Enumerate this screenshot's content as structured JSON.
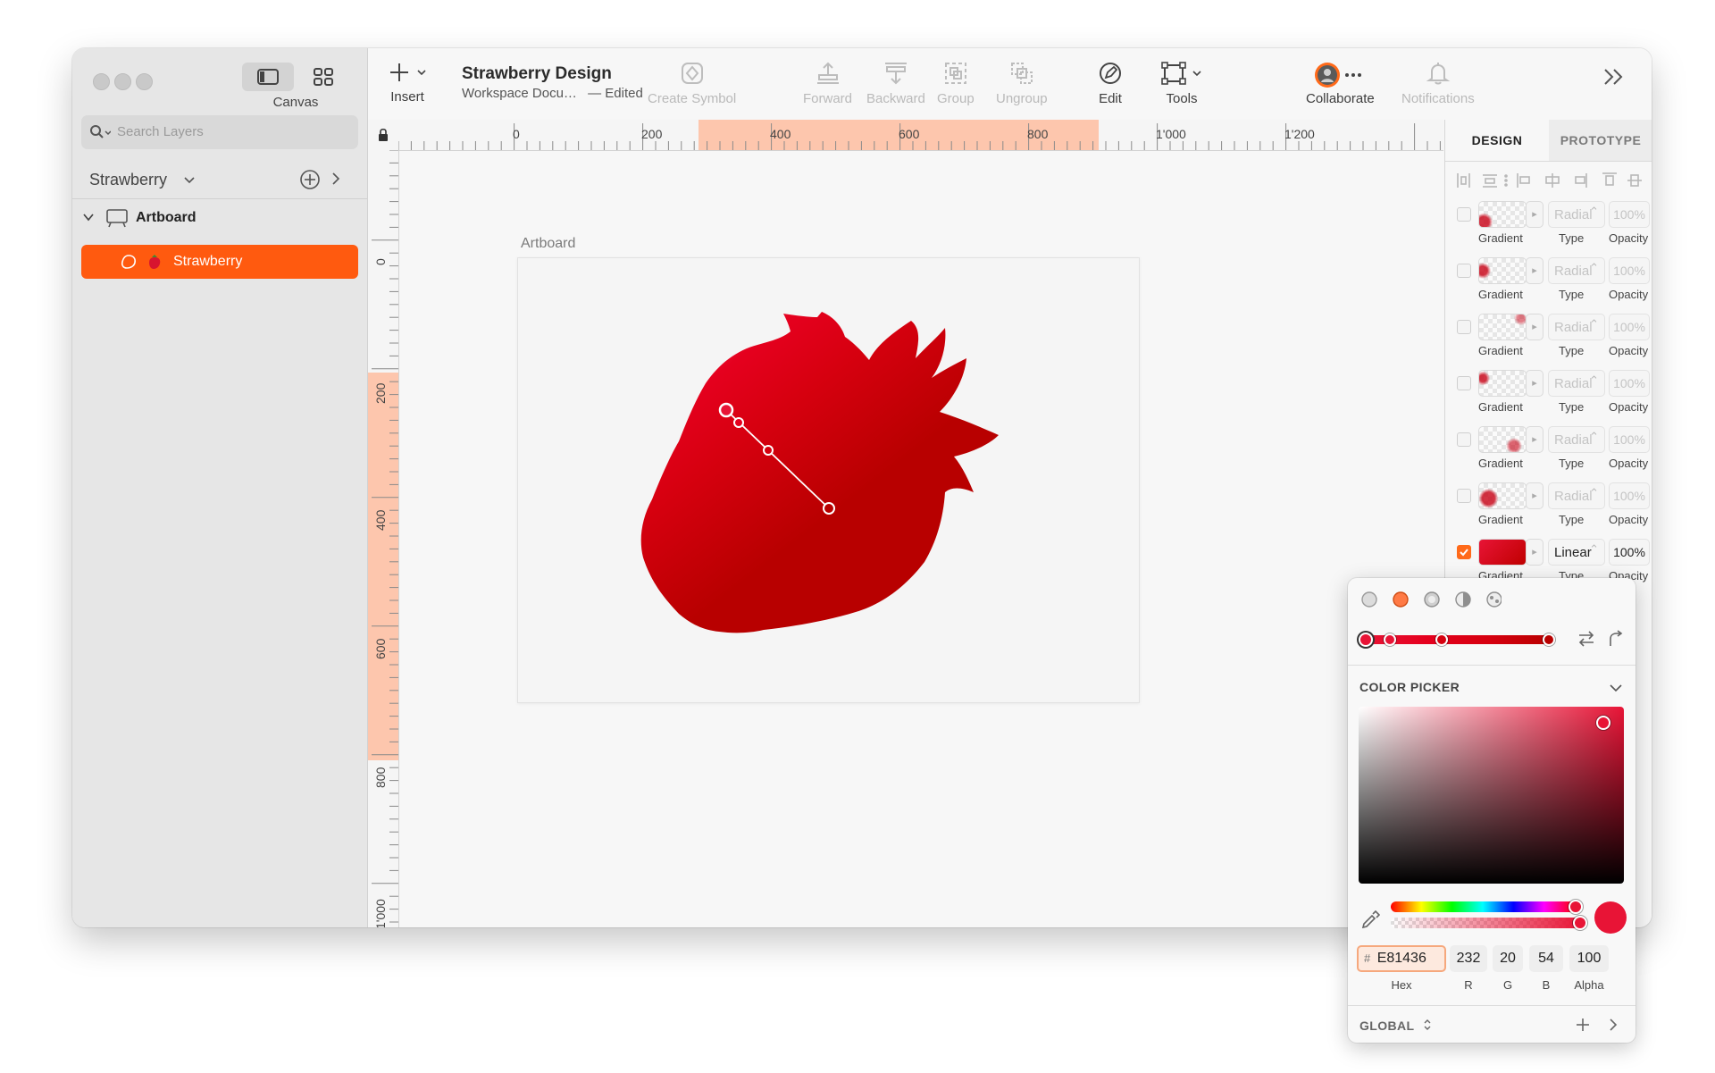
{
  "window": {
    "canvas_label": "Canvas",
    "search_placeholder": "Search Layers",
    "page_name": "Strawberry",
    "artboard_name": "Artboard",
    "layer_name": "Strawberry"
  },
  "toolbar": {
    "insert": "Insert",
    "doc_title": "Strawberry Design",
    "doc_location": "Workspace Docu…",
    "doc_status": "— Edited",
    "create_symbol": "Create Symbol",
    "forward": "Forward",
    "backward": "Backward",
    "group": "Group",
    "ungroup": "Ungroup",
    "edit": "Edit",
    "tools": "Tools",
    "collaborate": "Collaborate",
    "notifications": "Notifications"
  },
  "rulers": {
    "horizontal": [
      "0",
      "200",
      "400",
      "600",
      "800",
      "1'000",
      "1'200"
    ],
    "vertical": [
      "0",
      "200",
      "400",
      "600",
      "800",
      "1'000"
    ]
  },
  "canvas": {
    "artboard_title": "Artboard"
  },
  "inspector": {
    "tabs": [
      "DESIGN",
      "PROTOTYPE"
    ],
    "fills": [
      {
        "type": "Radial",
        "opacity": "100%",
        "enabled": false
      },
      {
        "type": "Radial",
        "opacity": "100%",
        "enabled": false
      },
      {
        "type": "Radial",
        "opacity": "100%",
        "enabled": false
      },
      {
        "type": "Radial",
        "opacity": "100%",
        "enabled": false
      },
      {
        "type": "Radial",
        "opacity": "100%",
        "enabled": false
      },
      {
        "type": "Radial",
        "opacity": "100%",
        "enabled": false
      },
      {
        "type": "Linear",
        "opacity": "100%",
        "enabled": true
      }
    ],
    "captions": {
      "gradient": "Gradient",
      "type": "Type",
      "opacity": "Opacity"
    }
  },
  "color_picker": {
    "title": "COLOR PICKER",
    "hex": "E81436",
    "hex_prefix": "#",
    "r": "232",
    "g": "20",
    "b": "54",
    "alpha": "100",
    "labels": {
      "hex": "Hex",
      "r": "R",
      "g": "G",
      "b": "B",
      "alpha": "Alpha"
    },
    "global": "GLOBAL",
    "current_color": "#E81436"
  },
  "colors": {
    "accent": "#FF5A0F",
    "strawberry_top": "#E81436",
    "strawberry_bottom": "#B50000"
  }
}
